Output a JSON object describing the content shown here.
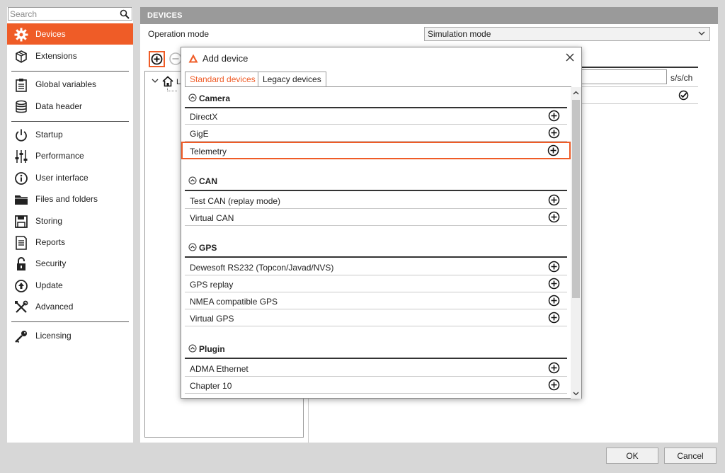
{
  "sidebar": {
    "search_placeholder": "Search",
    "items": [
      {
        "label": "Devices",
        "icon": "gear-icon"
      },
      {
        "label": "Extensions",
        "icon": "cube-icon"
      },
      {
        "label": "Global variables",
        "icon": "clipboard-icon"
      },
      {
        "label": "Data header",
        "icon": "database-icon"
      },
      {
        "label": "Startup",
        "icon": "power-icon"
      },
      {
        "label": "Performance",
        "icon": "sliders-icon"
      },
      {
        "label": "User interface",
        "icon": "info-icon"
      },
      {
        "label": "Files and folders",
        "icon": "folder-icon"
      },
      {
        "label": "Storing",
        "icon": "save-icon"
      },
      {
        "label": "Reports",
        "icon": "document-icon"
      },
      {
        "label": "Security",
        "icon": "lock-icon"
      },
      {
        "label": "Update",
        "icon": "upload-icon"
      },
      {
        "label": "Advanced",
        "icon": "tools-icon"
      },
      {
        "label": "Licensing",
        "icon": "key-icon"
      }
    ]
  },
  "main": {
    "header": "DEVICES",
    "operation_mode_label": "Operation mode",
    "operation_mode_value": "Simulation mode",
    "rate_unit": "s/s/ch",
    "tree_text": "L"
  },
  "footer": {
    "ok_label": "OK",
    "cancel_label": "Cancel"
  },
  "dialog": {
    "title": "Add device",
    "tabs": [
      {
        "label": "Standard devices",
        "active": true
      },
      {
        "label": "Legacy devices",
        "active": false
      }
    ],
    "sections": [
      {
        "title": "Camera",
        "devices": [
          "DirectX",
          "GigE",
          "Telemetry"
        ]
      },
      {
        "title": "CAN",
        "devices": [
          "Test CAN (replay mode)",
          "Virtual CAN"
        ]
      },
      {
        "title": "GPS",
        "devices": [
          "Dewesoft RS232 (Topcon/Javad/NVS)",
          "GPS replay",
          "NMEA compatible GPS",
          "Virtual GPS"
        ]
      },
      {
        "title": "Plugin",
        "devices": [
          "ADMA Ethernet",
          "Chapter 10"
        ]
      }
    ],
    "highlighted_device": "Telemetry"
  },
  "colors": {
    "accent": "#ef5c27",
    "header_gray": "#9a9a9a",
    "background": "#d7d7d7"
  }
}
